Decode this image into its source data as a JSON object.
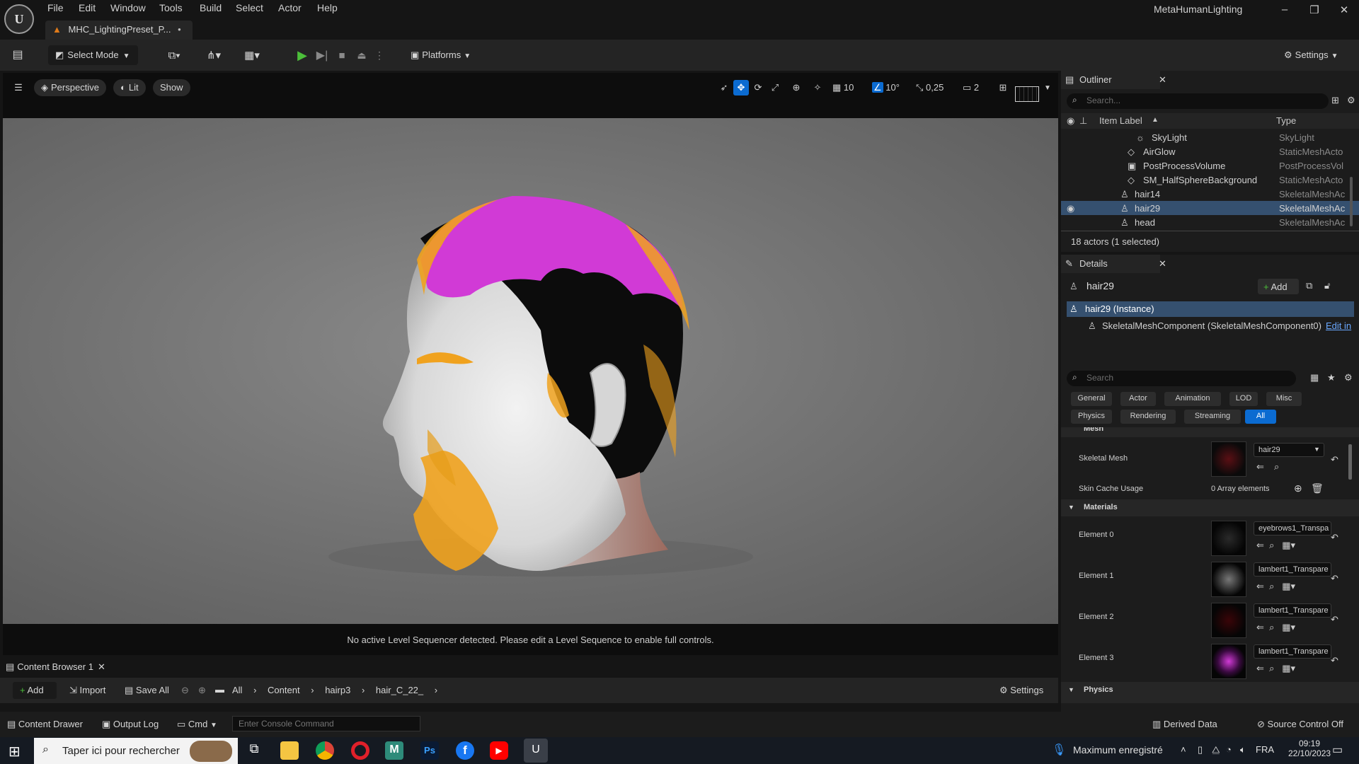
{
  "menu": [
    "File",
    "Edit",
    "Window",
    "Tools",
    "Build",
    "Select",
    "Actor",
    "Help"
  ],
  "project_name": "MetaHumanLighting",
  "doc_tab": "MHC_LightingPreset_P...",
  "toolbar": {
    "select_mode": "Select Mode",
    "platforms": "Platforms",
    "settings": "Settings"
  },
  "viewport": {
    "perspective": "Perspective",
    "lit": "Lit",
    "show": "Show",
    "grid_snap": "10",
    "angle_snap": "10°",
    "scale_snap": "0,25",
    "camera_speed": "2",
    "sequencer_msg": "No active Level Sequencer detected. Please edit a Level Sequence to enable full controls."
  },
  "outliner": {
    "title": "Outliner",
    "search_placeholder": "Search...",
    "col_label": "Item Label",
    "col_type": "Type",
    "rows": [
      {
        "label": "SkyLight",
        "type": "SkyLight"
      },
      {
        "label": "AirGlow",
        "type": "StaticMeshActo"
      },
      {
        "label": "PostProcessVolume",
        "type": "PostProcessVol"
      },
      {
        "label": "SM_HalfSphereBackground",
        "type": "StaticMeshActo"
      },
      {
        "label": "hair14",
        "type": "SkeletalMeshAc"
      },
      {
        "label": "hair29",
        "type": "SkeletalMeshAc"
      },
      {
        "label": "head",
        "type": "SkeletalMeshAc"
      }
    ],
    "footer": "18 actors (1 selected)"
  },
  "details": {
    "title": "Details",
    "actor_name": "hair29",
    "add_label": "Add",
    "instance": "hair29 (Instance)",
    "component": "SkeletalMeshComponent (SkeletalMeshComponent0)",
    "edit_in": "Edit in",
    "search_placeholder": "Search",
    "categories_row1": [
      "General",
      "Actor",
      "Animation",
      "LOD",
      "Misc"
    ],
    "categories_row2": [
      "Physics",
      "Rendering",
      "Streaming",
      "All"
    ],
    "mesh_section": "Mesh",
    "skeletal_mesh_label": "Skeletal Mesh",
    "skeletal_mesh_value": "hair29",
    "skin_cache_label": "Skin Cache Usage",
    "skin_cache_value": "0 Array elements",
    "materials_section": "Materials",
    "materials": [
      {
        "label": "Element 0",
        "value": "eyebrows1_Transpa"
      },
      {
        "label": "Element 1",
        "value": "lambert1_Transpare"
      },
      {
        "label": "Element 2",
        "value": "lambert1_Transpare"
      },
      {
        "label": "Element 3",
        "value": "lambert1_Transpare"
      }
    ],
    "physics_section": "Physics"
  },
  "content_browser": {
    "tab": "Content Browser 1",
    "add": "Add",
    "import": "Import",
    "save_all": "Save All",
    "path": [
      "All",
      "Content",
      "hairp3",
      "hair_C_22_"
    ],
    "settings": "Settings"
  },
  "statusbar": {
    "content_drawer": "Content Drawer",
    "output_log": "Output Log",
    "cmd": "Cmd",
    "console_placeholder": "Enter Console Command",
    "derived_data": "Derived Data",
    "source_control": "Source Control Off"
  },
  "taskbar": {
    "search_placeholder": "Taper ici pour rechercher",
    "notification": "Maximum enregistré",
    "lang": "FRA",
    "time": "09:19",
    "date": "22/10/2023"
  },
  "colors": {
    "accent_blue": "#0b6bd1",
    "selection": "#35506f",
    "play_green": "#4cbf3a",
    "hair_magenta": "#d13ad6",
    "hair_orange": "#f0a21e"
  }
}
